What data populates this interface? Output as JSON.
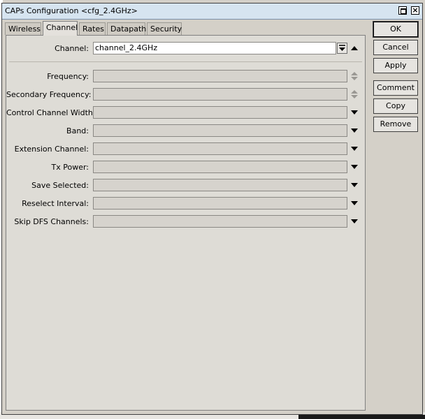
{
  "window": {
    "title": "CAPs Configuration <cfg_2.4GHz>",
    "close_glyph": "×"
  },
  "tabs": [
    {
      "label": "Wireless",
      "active": false
    },
    {
      "label": "Channel",
      "active": true
    },
    {
      "label": "Rates",
      "active": false
    },
    {
      "label": "Datapath",
      "active": false
    },
    {
      "label": "Security",
      "active": false
    }
  ],
  "channel": {
    "label": "Channel:",
    "value": "channel_2.4GHz"
  },
  "fields": [
    {
      "label": "Frequency:",
      "value": "",
      "control": "updown"
    },
    {
      "label": "Secondary Frequency:",
      "value": "",
      "control": "updown"
    },
    {
      "label": "Control Channel Width:",
      "value": "",
      "control": "dropdown"
    },
    {
      "label": "Band:",
      "value": "",
      "control": "dropdown"
    },
    {
      "label": "Extension Channel:",
      "value": "",
      "control": "dropdown"
    },
    {
      "label": "Tx Power:",
      "value": "",
      "control": "dropdown"
    },
    {
      "label": "Save Selected:",
      "value": "",
      "control": "dropdown"
    },
    {
      "label": "Reselect Interval:",
      "value": "",
      "control": "dropdown"
    },
    {
      "label": "Skip DFS Channels:",
      "value": "",
      "control": "dropdown"
    }
  ],
  "buttons": {
    "ok": "OK",
    "cancel": "Cancel",
    "apply": "Apply",
    "comment": "Comment",
    "copy": "Copy",
    "remove": "Remove"
  }
}
